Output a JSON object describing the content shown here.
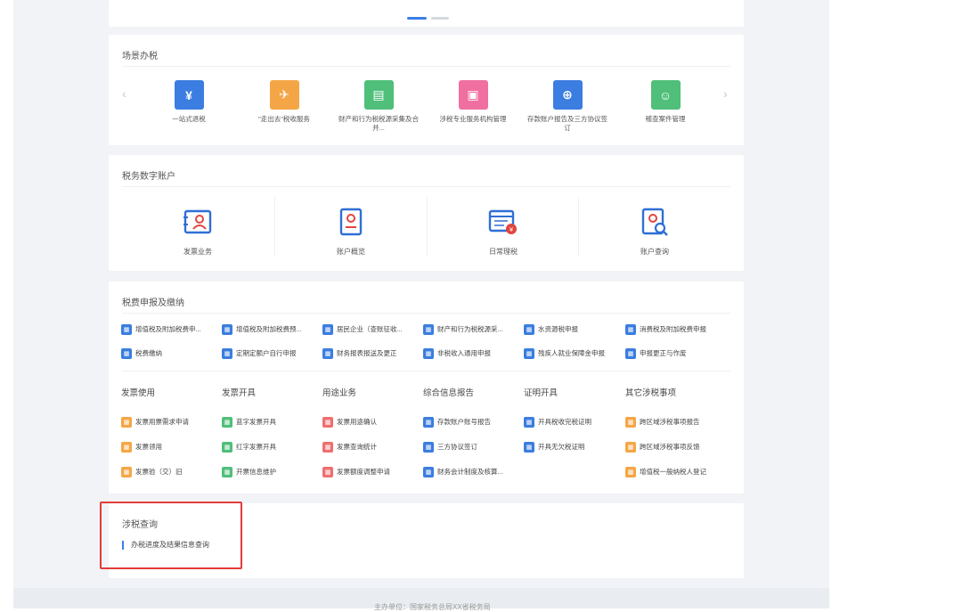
{
  "scenario": {
    "title": "场景办税",
    "prev_arrow": "‹",
    "next_arrow": "›",
    "items": [
      {
        "label": "一站式退税",
        "color": "#3b7de0",
        "icon": "refund-icon"
      },
      {
        "label": "\"走出去\"税收服务",
        "color": "#f4a646",
        "icon": "globe-icon"
      },
      {
        "label": "财产和行为税税源采集及合并...",
        "color": "#4fbf7a",
        "icon": "form-icon"
      },
      {
        "label": "涉税专业服务机构管理",
        "color": "#ef6fa0",
        "icon": "building-icon"
      },
      {
        "label": "存款账户报告及三方协议签订",
        "color": "#3b7de0",
        "icon": "contract-icon"
      },
      {
        "label": "稽查案件管理",
        "color": "#4fbf7a",
        "icon": "audit-icon"
      }
    ]
  },
  "digital": {
    "title": "税务数字账户",
    "items": [
      {
        "label": "发票业务",
        "icon": "invoice-icon"
      },
      {
        "label": "账户概览",
        "icon": "account-icon"
      },
      {
        "label": "日常理税",
        "icon": "calendar-tax-icon"
      },
      {
        "label": "账户查询",
        "icon": "account-search-icon"
      }
    ]
  },
  "declare": {
    "title": "税费申报及缴纳",
    "row1": [
      {
        "label": "增值税及附加税费申...",
        "color": "#3b7de0"
      },
      {
        "label": "增值税及附加税费预...",
        "color": "#3b7de0"
      },
      {
        "label": "居民企业（查账征收...",
        "color": "#3b7de0"
      },
      {
        "label": "财产和行为税税源采...",
        "color": "#3b7de0"
      },
      {
        "label": "水资源税申报",
        "color": "#3b7de0"
      },
      {
        "label": "消费税及附加税费申报",
        "color": "#3b7de0"
      }
    ],
    "row2": [
      {
        "label": "税费缴纳",
        "color": "#3b7de0"
      },
      {
        "label": "定期定额户自行申报",
        "color": "#3b7de0"
      },
      {
        "label": "财务报表报送及更正",
        "color": "#3b7de0"
      },
      {
        "label": "非税收入通用申报",
        "color": "#3b7de0"
      },
      {
        "label": "残疾人就业保障金申报",
        "color": "#3b7de0"
      },
      {
        "label": "申报更正与作废",
        "color": "#3b7de0"
      }
    ],
    "columns": [
      {
        "head": "发票使用",
        "items": [
          {
            "label": "发票用票需求申请",
            "color": "#f4a646"
          },
          {
            "label": "发票领用",
            "color": "#f4a646"
          },
          {
            "label": "发票验（交）旧",
            "color": "#f4a646"
          }
        ]
      },
      {
        "head": "发票开具",
        "items": [
          {
            "label": "蓝字发票开具",
            "color": "#4fbf7a"
          },
          {
            "label": "红字发票开具",
            "color": "#4fbf7a"
          },
          {
            "label": "开票信息维护",
            "color": "#4fbf7a"
          }
        ]
      },
      {
        "head": "用途业务",
        "items": [
          {
            "label": "发票用途确认",
            "color": "#ef6f6f"
          },
          {
            "label": "发票查询统计",
            "color": "#ef6f6f"
          },
          {
            "label": "发票额度调整申请",
            "color": "#ef6f6f"
          }
        ]
      },
      {
        "head": "综合信息报告",
        "items": [
          {
            "label": "存款账户账号报告",
            "color": "#3b7de0"
          },
          {
            "label": "三方协议签订",
            "color": "#3b7de0"
          },
          {
            "label": "财务会计制度及核算...",
            "color": "#3b7de0"
          }
        ]
      },
      {
        "head": "证明开具",
        "items": [
          {
            "label": "开具税收完税证明",
            "color": "#3b7de0"
          },
          {
            "label": "开具无欠税证明",
            "color": "#3b7de0"
          }
        ]
      },
      {
        "head": "其它涉税事项",
        "items": [
          {
            "label": "跨区域涉税事项报告",
            "color": "#f4a646"
          },
          {
            "label": "跨区域涉税事项反馈",
            "color": "#f4a646"
          },
          {
            "label": "增值税一般纳税人登记",
            "color": "#f4a646"
          }
        ]
      }
    ]
  },
  "query": {
    "title": "涉税查询",
    "link": "办税进度及结果信息查询"
  },
  "footer": {
    "text": "主办单位：国家税务总局XX省税务局"
  },
  "colors": {
    "accent": "#3d7ee6",
    "highlight": "#e23b3b"
  }
}
